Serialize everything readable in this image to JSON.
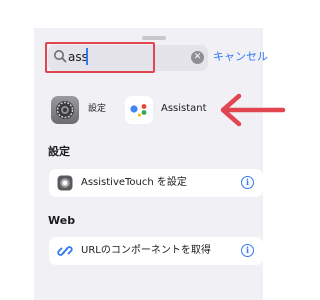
{
  "search": {
    "query": "ass",
    "clear_icon": "xmark-circle-icon",
    "cancel_label": "キャンセル"
  },
  "apps": [
    {
      "label": "設定",
      "icon": "settings-gear-icon"
    },
    {
      "label": "Assistant",
      "icon": "google-assistant-icon"
    }
  ],
  "sections": [
    {
      "header": "設定",
      "actions": [
        {
          "label": "AssistiveTouch を設定",
          "icon": "assistivetouch-icon",
          "info_icon": "info-icon"
        }
      ]
    },
    {
      "header": "Web",
      "actions": [
        {
          "label": "URLのコンポーネントを取得",
          "icon": "link-icon",
          "info_icon": "info-icon"
        }
      ]
    }
  ],
  "colors": {
    "accent": "#3478f6",
    "highlight": "#e14550",
    "sheet_background": "#f1f1f5"
  }
}
